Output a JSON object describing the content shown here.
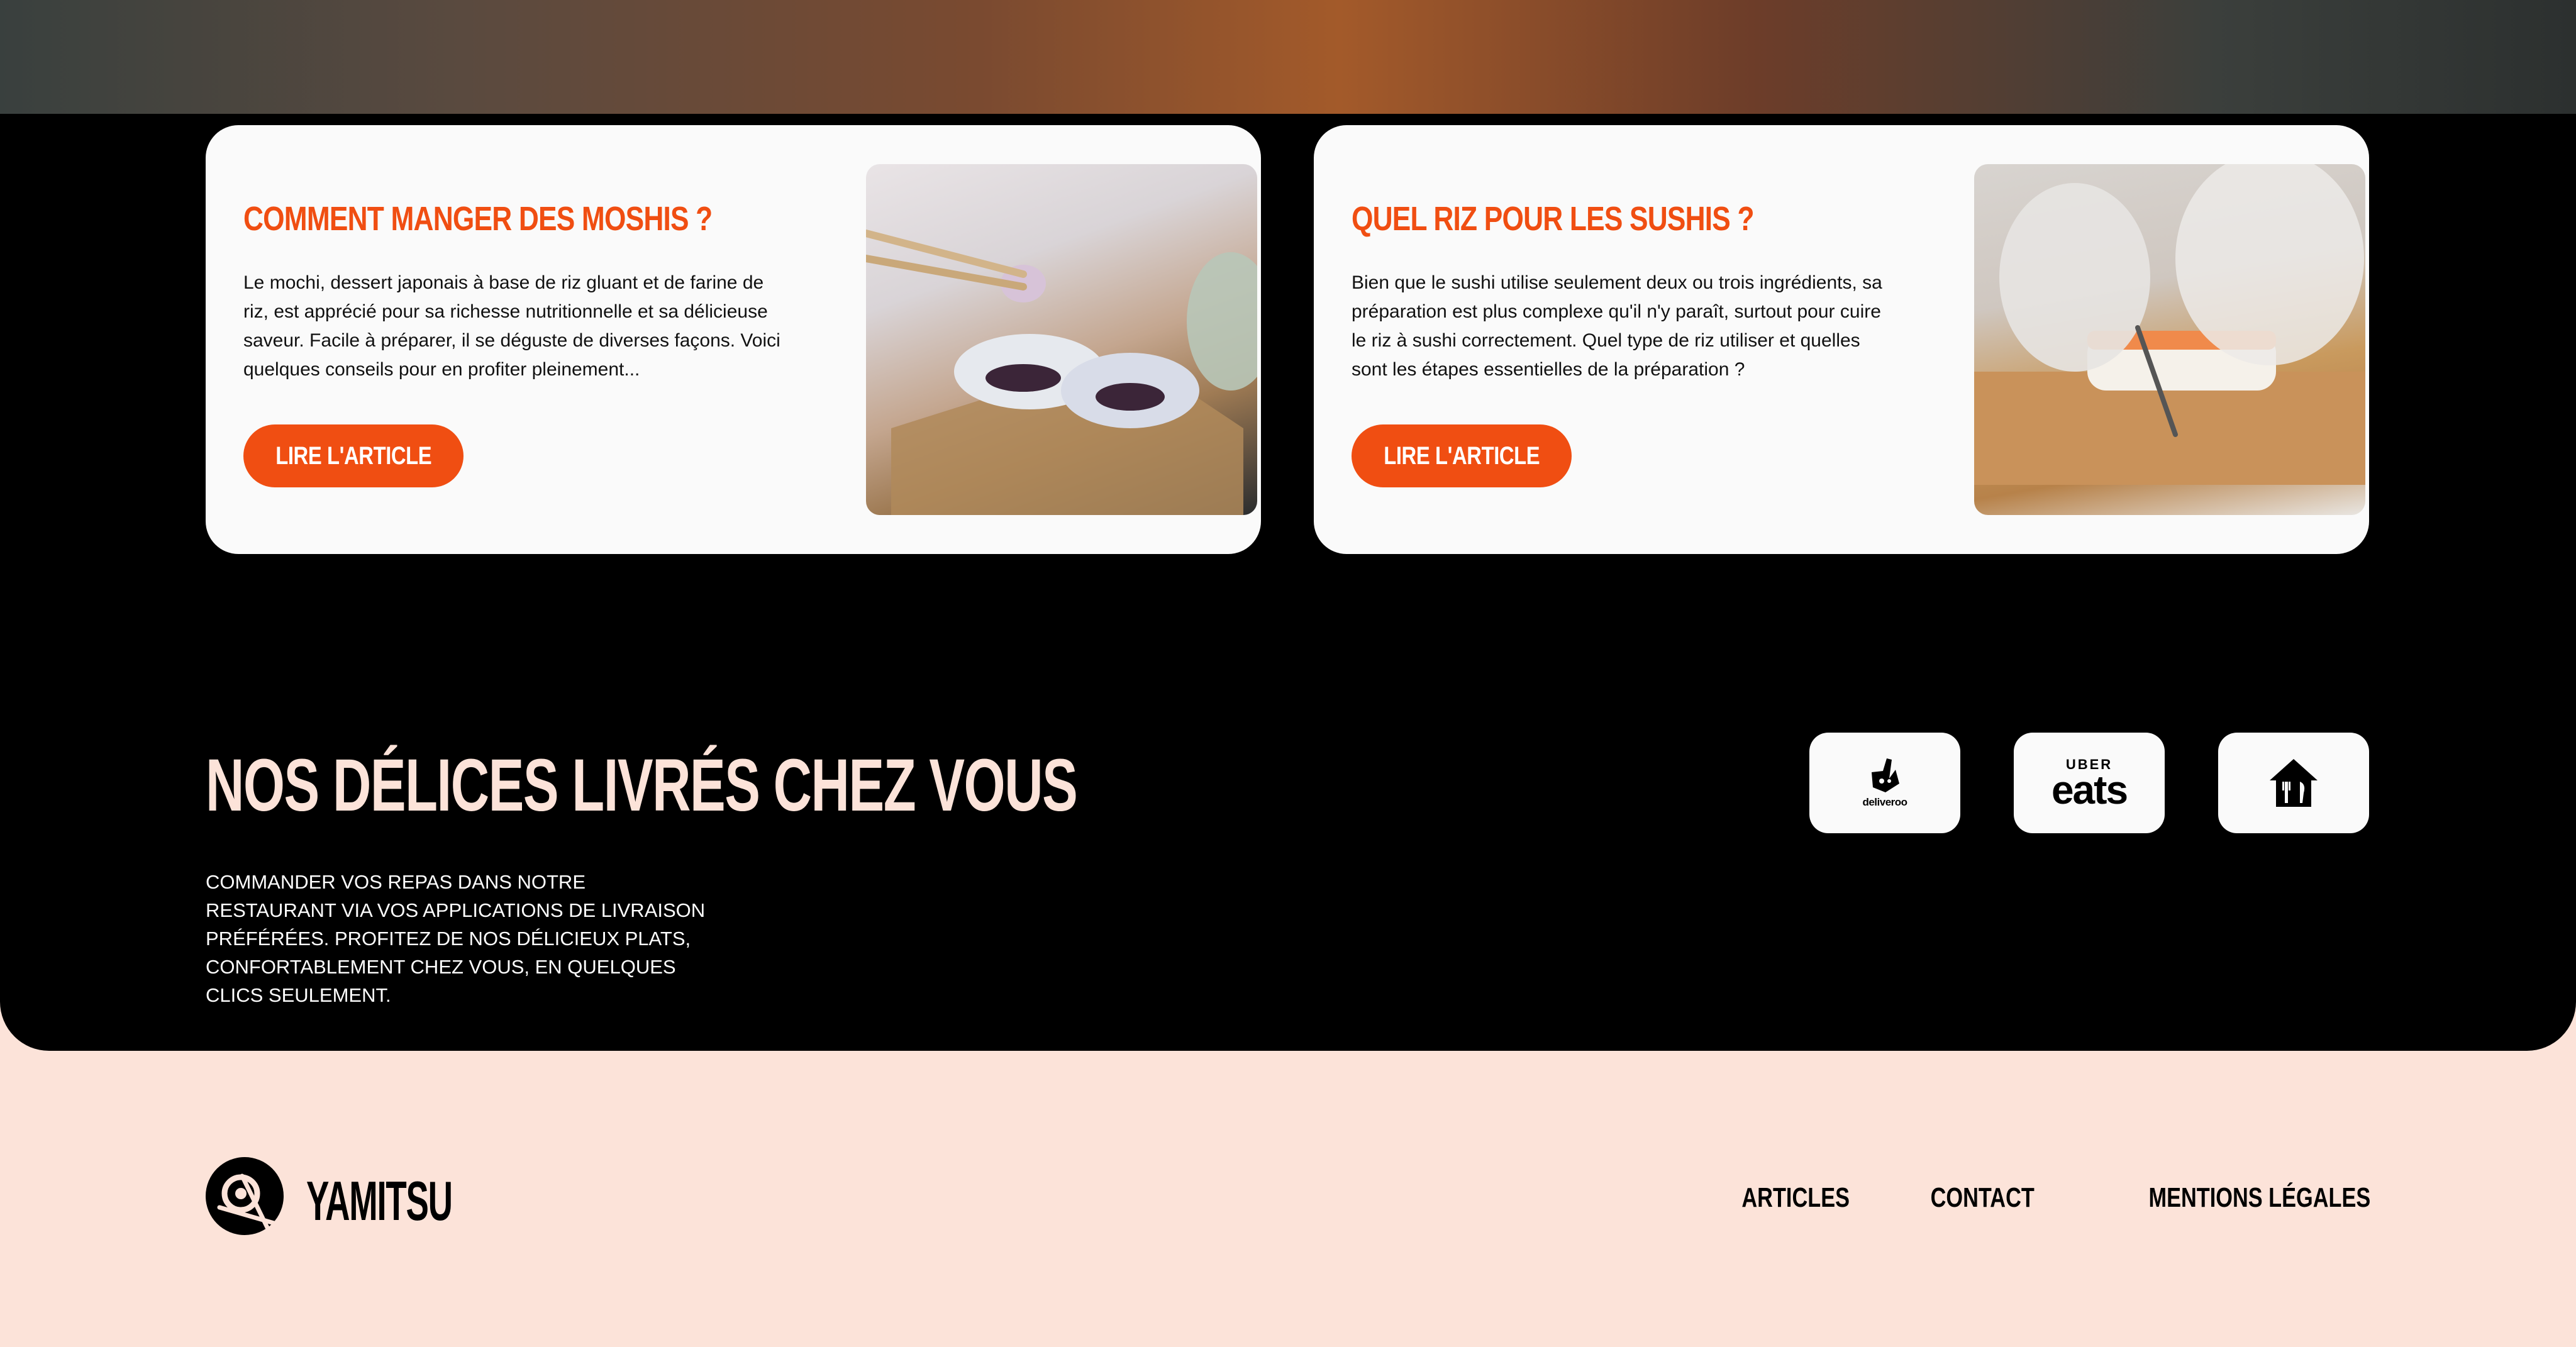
{
  "articles": [
    {
      "title": "COMMENT MANGER DES MOSHIS ?",
      "excerpt": "Le mochi, dessert japonais à base de riz gluant et de farine de riz, est apprécié pour sa richesse nutritionnelle et sa délicieuse saveur. Facile à préparer, il se déguste de diverses façons. Voici quelques conseils pour en profiter pleinement...",
      "button_label": "LIRE L'ARTICLE"
    },
    {
      "title": "QUEL RIZ POUR LES SUSHIS ?",
      "excerpt": "Bien que le sushi utilise seulement deux ou trois ingrédients, sa préparation est plus complexe qu'il n'y paraît, surtout pour cuire le riz à sushi correctement. Quel type de riz utiliser et quelles sont les étapes essentielles de la préparation ?",
      "button_label": "LIRE L'ARTICLE"
    }
  ],
  "delivery": {
    "title": "NOS DÉLICES LIVRÉS CHEZ VOUS",
    "text": "COMMANDER VOS REPAS DANS NOTRE RESTAURANT VIA VOS APPLICATIONS DE LIVRAISON PRÉFÉRÉES. PROFITEZ DE NOS DÉLICIEUX PLATS, CONFORTABLEMENT CHEZ VOUS, EN QUELQUES CLICS SEULEMENT.",
    "apps": {
      "deliveroo": "deliveroo",
      "uber_top": "UBER",
      "uber_bottom": "eats"
    }
  },
  "footer": {
    "brand": "YAMITSU",
    "nav": [
      "ARTICLES",
      "CONTACT",
      "MENTIONS LÉGALES"
    ]
  },
  "colors": {
    "accent": "#f04e12",
    "dark": "#000000",
    "cream": "#fce3d9",
    "card": "#fafafa"
  },
  "icons": [
    "deliveroo-logo-icon",
    "uber-eats-logo-icon",
    "just-eat-logo-icon",
    "yamitsu-logo-icon"
  ]
}
